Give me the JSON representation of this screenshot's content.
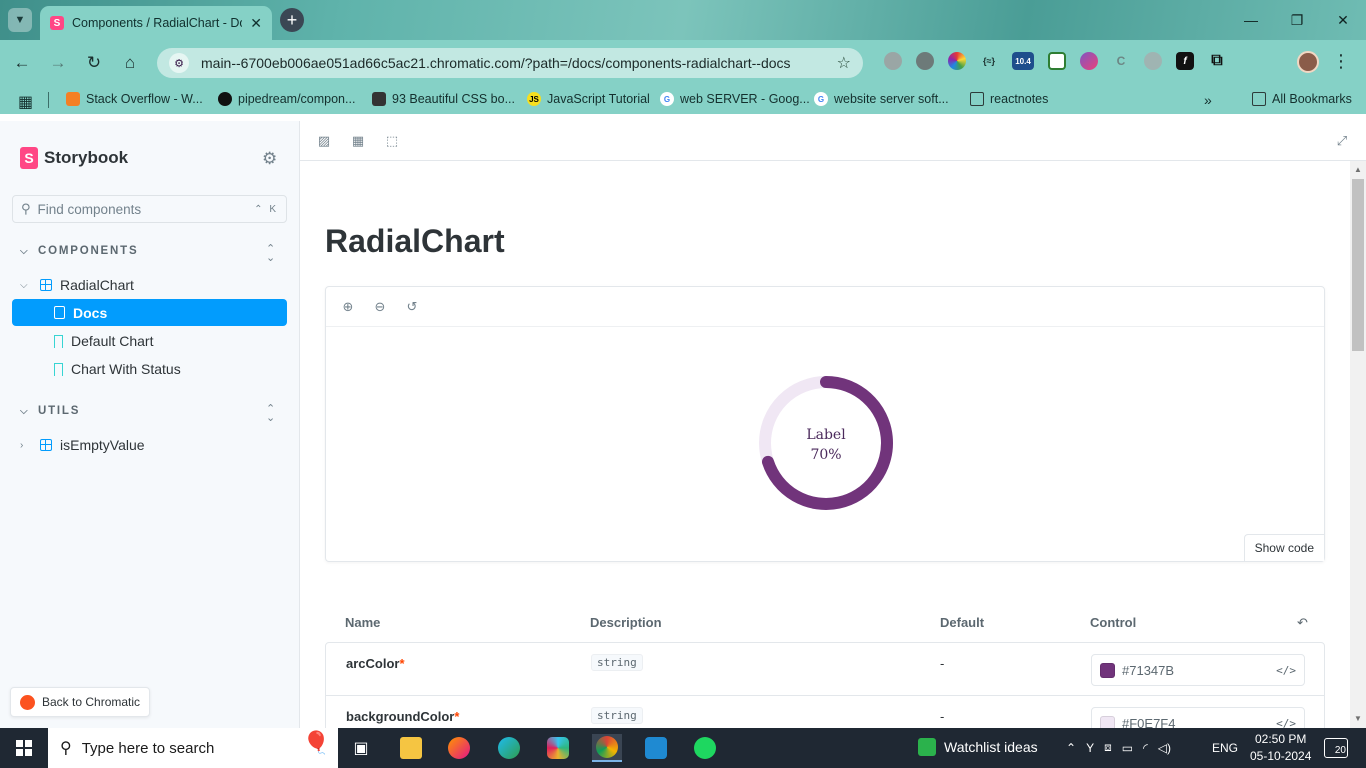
{
  "browser": {
    "tab_title": "Components / RadialChart - Do",
    "url": "main--6700eb006ae051ad66c5ac21.chromatic.com/?path=/docs/components-radialchart--docs",
    "extensions": [
      "webcam-icon",
      "bug-icon",
      "color-wheel-icon",
      "json-icon",
      "badge-10.4-icon",
      "sheets-icon",
      "gradient-icon",
      "puzzle-c-icon",
      "circle-icon",
      "fx-icon",
      "extensions-icon"
    ],
    "extension_badge": "10.4",
    "bookmarks": [
      {
        "label": "Stack Overflow - W...",
        "icon": "stackoverflow-icon",
        "color": "#f48024"
      },
      {
        "label": "pipedream/compon...",
        "icon": "github-icon",
        "color": "#111111"
      },
      {
        "label": "93 Beautiful CSS bo...",
        "icon": "codepen-icon",
        "color": "#333333"
      },
      {
        "label": "JavaScript Tutorial",
        "icon": "js-icon",
        "color": "#f7df1e"
      },
      {
        "label": "web SERVER - Goog...",
        "icon": "google-icon",
        "color": "#4285f4"
      },
      {
        "label": "website server soft...",
        "icon": "google-icon",
        "color": "#4285f4"
      },
      {
        "label": "reactnotes",
        "icon": "folder-icon",
        "color": "#2d3b3a"
      }
    ],
    "all_bookmarks": "All Bookmarks"
  },
  "sidebar": {
    "brand": "Storybook",
    "search_placeholder": "Find components",
    "search_shortcut": "⌃ K",
    "groups": [
      {
        "label": "COMPONENTS"
      },
      {
        "label": "UTILS"
      }
    ],
    "items": {
      "radialchart": "RadialChart",
      "docs": "Docs",
      "default_chart": "Default Chart",
      "chart_with_status": "Chart With Status",
      "isemptyvalue": "isEmptyValue"
    },
    "back_button": "Back to Chromatic"
  },
  "main": {
    "title": "RadialChart",
    "show_code": "Show code",
    "chart": {
      "label": "Label",
      "value_text": "70%",
      "value": 70,
      "arc_color": "#71347B",
      "background_color": "#F0E7F4"
    },
    "args_table": {
      "headers": {
        "name": "Name",
        "description": "Description",
        "default": "Default",
        "control": "Control"
      },
      "rows": [
        {
          "name": "arcColor",
          "required": "*",
          "type": "string",
          "default": "-",
          "control": "#71347B",
          "swatch": "#71347B"
        },
        {
          "name": "backgroundColor",
          "required": "*",
          "type": "string",
          "default": "-",
          "control": "#F0E7F4",
          "swatch": "#F0E7F4"
        }
      ]
    }
  },
  "taskbar": {
    "search_placeholder": "Type here to search",
    "widget": "Watchlist ideas",
    "language": "ENG",
    "time": "02:50 PM",
    "date": "05-10-2024",
    "notification_count": "20"
  }
}
